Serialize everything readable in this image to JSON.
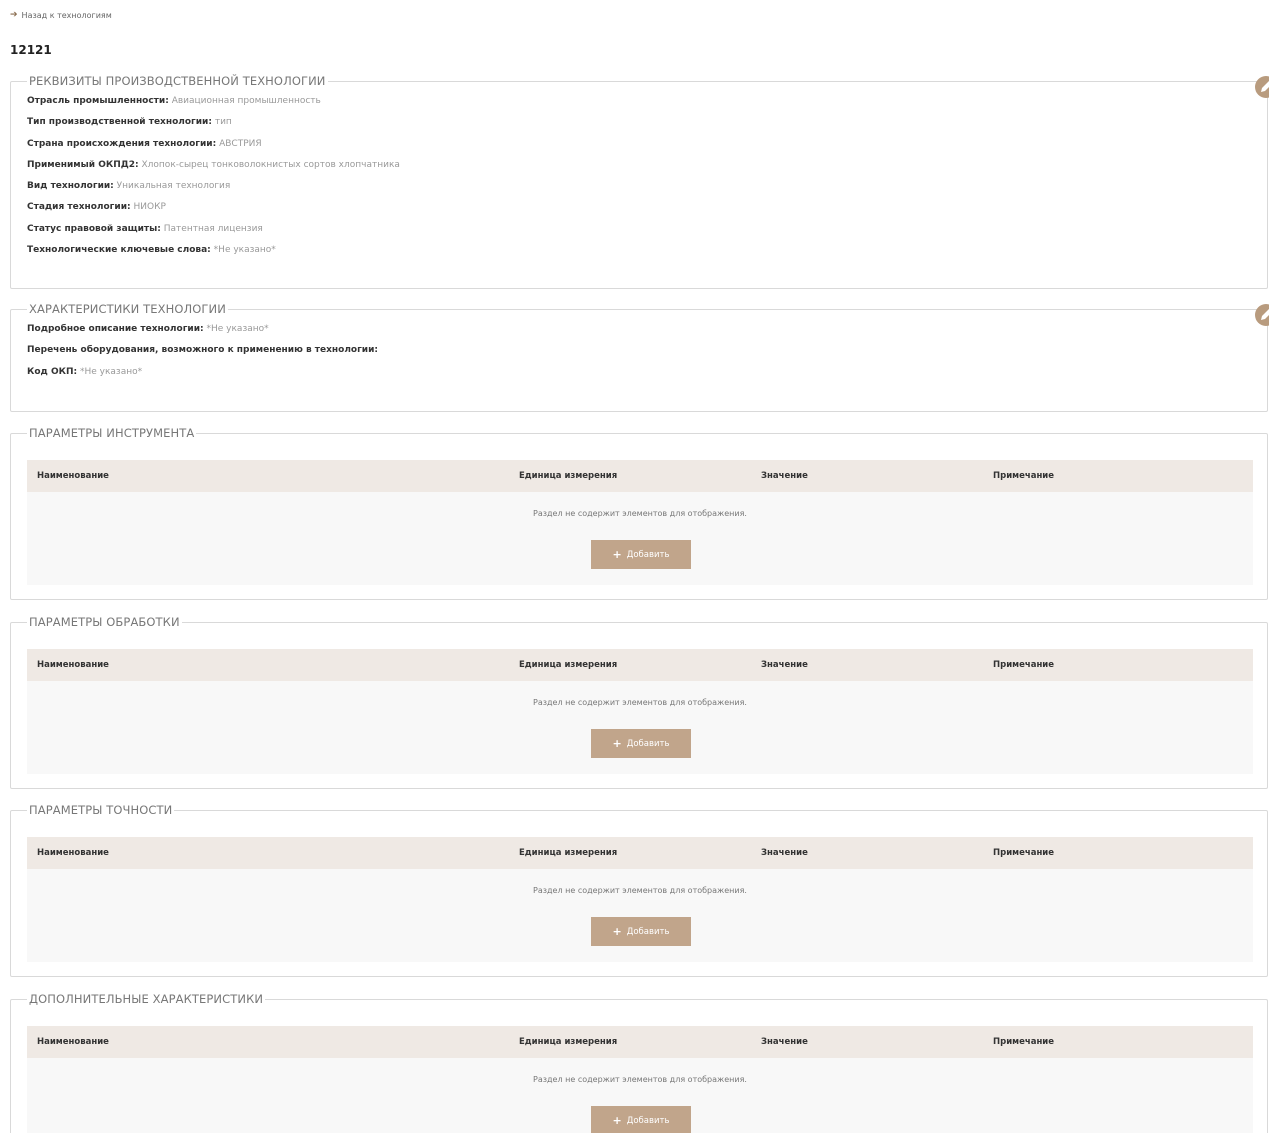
{
  "back_link": {
    "icon": "arrow-left-icon",
    "label": "Назад к технологиям"
  },
  "record_title": "12121",
  "requisites": {
    "legend": "РЕКВИЗИТЫ ПРОИЗВОДСТВЕННОЙ ТЕХНОЛОГИИ",
    "fields": [
      {
        "label": "Отрасль промышленности:",
        "value": "Авиационная промышленность"
      },
      {
        "label": "Тип производственной технологии:",
        "value": "тип"
      },
      {
        "label": "Страна происхождения технологии:",
        "value": "АВСТРИЯ"
      },
      {
        "label": "Применимый ОКПД2:",
        "value": "Хлопок-сырец тонковолокнистых сортов хлопчатника"
      },
      {
        "label": "Вид технологии:",
        "value": "Уникальная технология"
      },
      {
        "label": "Стадия технологии:",
        "value": "НИОКР"
      },
      {
        "label": "Статус правовой защиты:",
        "value": "Патентная лицензия"
      },
      {
        "label": "Технологические ключевые слова:",
        "value": "*Не указано*"
      }
    ]
  },
  "characteristics": {
    "legend": "ХАРАКТЕРИСТИКИ ТЕХНОЛОГИИ",
    "fields": [
      {
        "label": "Подробное описание технологии:",
        "value": "*Не указано*"
      },
      {
        "label": "Перечень оборудования, возможного к применению в технологии:",
        "value": ""
      },
      {
        "label": "Код ОКП:",
        "value": "*Не указано*"
      }
    ]
  },
  "table_columns": {
    "name": "Наименование",
    "unit": "Единица измерения",
    "value": "Значение",
    "note": "Примечание"
  },
  "param_sections": [
    {
      "legend": "ПАРАМЕТРЫ ИНСТРУМЕНТА",
      "empty_message": "Раздел не содержит элементов для отображения.",
      "add_label": "Добавить"
    },
    {
      "legend": "ПАРАМЕТРЫ ОБРАБОТКИ",
      "empty_message": "Раздел не содержит элементов для отображения.",
      "add_label": "Добавить"
    },
    {
      "legend": "ПАРАМЕТРЫ ТОЧНОСТИ",
      "empty_message": "Раздел не содержит элементов для отображения.",
      "add_label": "Добавить"
    },
    {
      "legend": "ДОПОЛНИТЕЛЬНЫЕ ХАРАКТЕРИСТИКИ",
      "empty_message": "Раздел не содержит элементов для отображения.",
      "add_label": "Добавить"
    }
  ],
  "edit_icon": "pencil-icon",
  "colors": {
    "accent": "#c1a58b",
    "header_bg": "#efe9e4",
    "body_bg": "#f8f8f8"
  }
}
